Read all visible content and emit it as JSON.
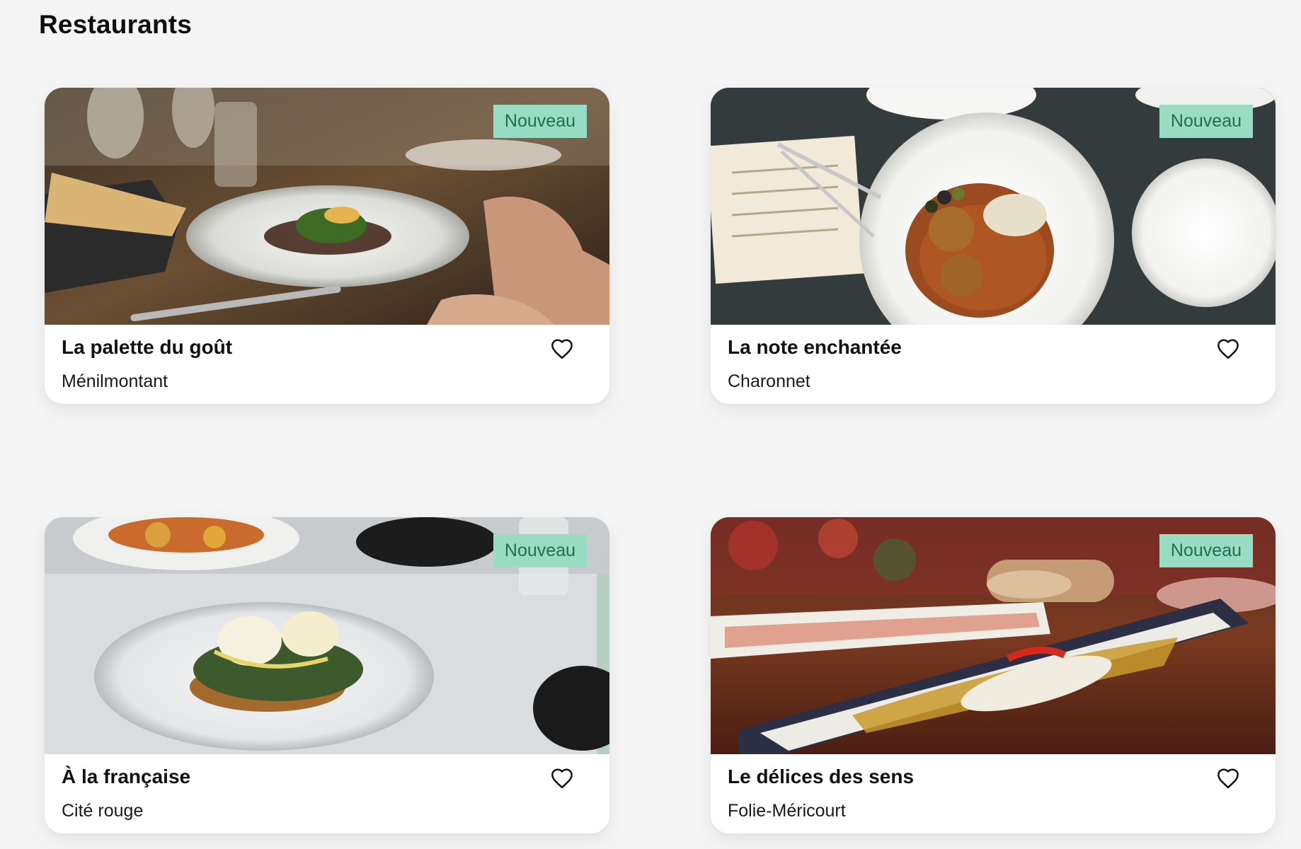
{
  "page": {
    "title": "Restaurants"
  },
  "theme": {
    "background": "#f5f5f5",
    "card_background": "#ffffff",
    "badge_background": "#98dcc3",
    "badge_text": "#1f6d52"
  },
  "restaurants": [
    {
      "name": "La palette du goût",
      "neighborhood": "Ménilmontant",
      "badge": "Nouveau",
      "favorite_icon": "heart-outline-icon",
      "image_description": "plated dish with greens on a restaurant table"
    },
    {
      "name": "La note enchantée",
      "neighborhood": "Charonnet",
      "badge": "Nouveau",
      "favorite_icon": "heart-outline-icon",
      "image_description": "overhead plate with croquettes and olives"
    },
    {
      "name": "À la française",
      "neighborhood": "Cité rouge",
      "badge": "Nouveau",
      "favorite_icon": "heart-outline-icon",
      "image_description": "eggs benedict on a white plate"
    },
    {
      "name": "Le délices des sens",
      "neighborhood": "Folie-Méricourt",
      "badge": "Nouveau",
      "favorite_icon": "heart-outline-icon",
      "image_description": "fish dish on long ceramic plates"
    }
  ]
}
